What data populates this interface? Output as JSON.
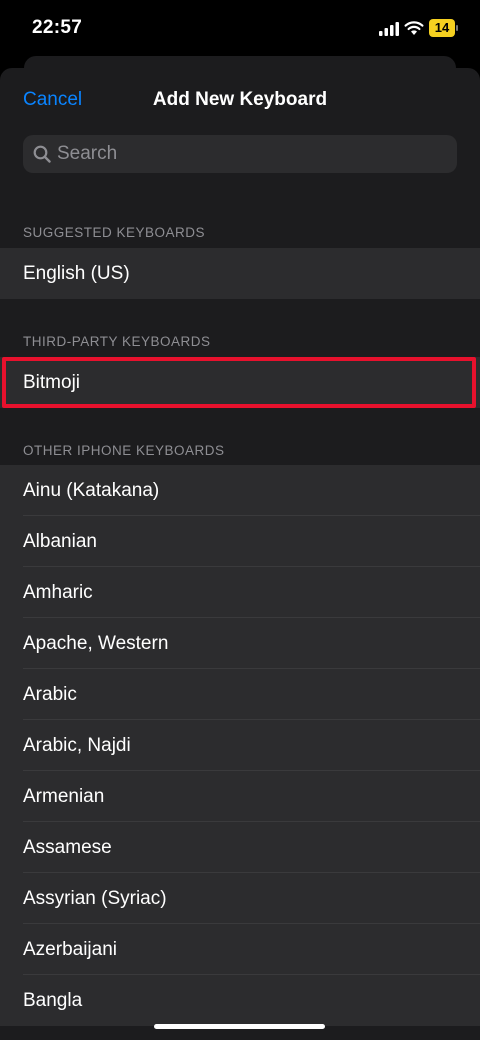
{
  "status_bar": {
    "time": "22:57",
    "battery": "14"
  },
  "nav": {
    "cancel": "Cancel",
    "title": "Add New Keyboard"
  },
  "search": {
    "placeholder": "Search"
  },
  "sections": {
    "suggested": {
      "header": "SUGGESTED KEYBOARDS",
      "items": [
        "English (US)"
      ]
    },
    "third_party": {
      "header": "THIRD-PARTY KEYBOARDS",
      "items": [
        "Bitmoji"
      ]
    },
    "other": {
      "header": "OTHER IPHONE KEYBOARDS",
      "items": [
        "Ainu (Katakana)",
        "Albanian",
        "Amharic",
        "Apache, Western",
        "Arabic",
        "Arabic, Najdi",
        "Armenian",
        "Assamese",
        "Assyrian (Syriac)",
        "Azerbaijani",
        "Bangla"
      ]
    }
  },
  "colors": {
    "accent": "#0a84ff",
    "highlight": "#e8112d",
    "battery": "#f5d020"
  }
}
